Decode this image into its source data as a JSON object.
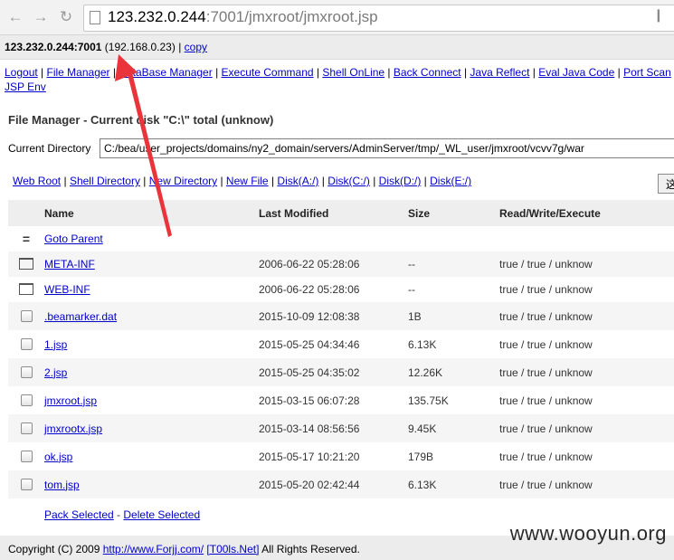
{
  "browser": {
    "back_icon": "back-arrow-icon",
    "forward_icon": "forward-arrow-icon",
    "reload_icon": "reload-icon",
    "url_host": "123.232.0.244",
    "url_rest": ":7001/jmxroot/jmxroot.jsp"
  },
  "header": {
    "host_port": "123.232.0.244:7001",
    "ip_open": " (",
    "internal_ip": "192.168.0.23",
    "ip_close": ") | ",
    "copy_link": "copy"
  },
  "menu": {
    "items": [
      "Logout",
      "File Manager",
      "DataBase Manager",
      "Execute Command",
      "Shell OnLine",
      "Back Connect",
      "Java Reflect",
      "Eval Java Code",
      "Port Scan"
    ],
    "row2": "JSP Env",
    "separator": " | "
  },
  "file_manager": {
    "title": "File Manager - Current disk \"C:\\\" total (unknow)",
    "current_dir_label": "Current Directory",
    "current_dir_value": "C:/bea/user_projects/domains/ny2_domain/servers/AdminServer/tmp/_WL_user/jmxroot/vcvv7g/war",
    "go_button": "这",
    "toolbar": [
      "Web Root",
      "Shell Directory",
      "New Directory",
      "New File",
      "Disk(A:/)",
      "Disk(C:/)",
      "Disk(D:/)",
      "Disk(E:/)"
    ],
    "columns": [
      "Name",
      "Last Modified",
      "Size",
      "Read/Write/Execute"
    ],
    "parent": {
      "symbol": "=",
      "label": "Goto Parent"
    },
    "rows": [
      {
        "type": "folder",
        "name": "META-INF",
        "modified": "2006-06-22 05:28:06",
        "size": "--",
        "rwx": "true / true / unknow"
      },
      {
        "type": "folder",
        "name": "WEB-INF",
        "modified": "2006-06-22 05:28:06",
        "size": "--",
        "rwx": "true / true / unknow"
      },
      {
        "type": "file",
        "name": ".beamarker.dat",
        "modified": "2015-10-09 12:08:38",
        "size": "1B",
        "rwx": "true / true / unknow"
      },
      {
        "type": "file",
        "name": "1.jsp",
        "modified": "2015-05-25 04:34:46",
        "size": "6.13K",
        "rwx": "true / true / unknow"
      },
      {
        "type": "file",
        "name": "2.jsp",
        "modified": "2015-05-25 04:35:02",
        "size": "12.26K",
        "rwx": "true / true / unknow"
      },
      {
        "type": "file",
        "name": "jmxroot.jsp",
        "modified": "2015-03-15 06:07:28",
        "size": "135.75K",
        "rwx": "true / true / unknow"
      },
      {
        "type": "file",
        "name": "jmxrootx.jsp",
        "modified": "2015-03-14 08:56:56",
        "size": "9.45K",
        "rwx": "true / true / unknow"
      },
      {
        "type": "file",
        "name": "ok.jsp",
        "modified": "2015-05-17 10:21:20",
        "size": "179B",
        "rwx": "true / true / unknow"
      },
      {
        "type": "file",
        "name": "tom.jsp",
        "modified": "2015-05-20 02:42:44",
        "size": "6.13K",
        "rwx": "true / true / unknow"
      }
    ],
    "pack_selected": "Pack Selected",
    "action_sep": " - ",
    "delete_selected": "Delete Selected"
  },
  "footer": {
    "prefix": "Copyright (C) 2009 ",
    "link1": "http://www.Forjj.com/",
    "space": " ",
    "link2": "[T00ls.Net]",
    "suffix": " All Rights Reserved."
  },
  "watermark": "www.wooyun.org",
  "colors": {
    "link": "#0000cc",
    "annotation_arrow": "#e8343a"
  }
}
